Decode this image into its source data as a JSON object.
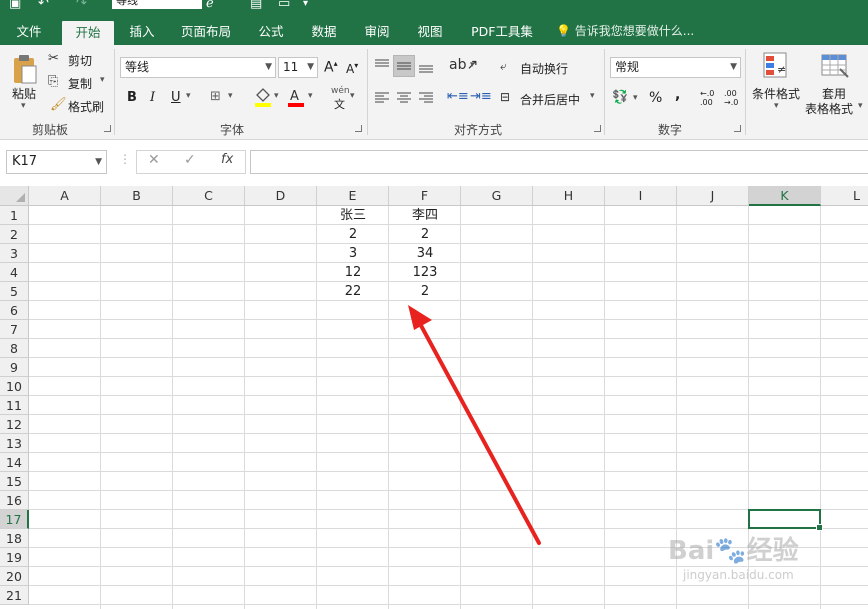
{
  "quick_access": {
    "font_name": "等线"
  },
  "tabs": [
    {
      "label": "文件",
      "active": false
    },
    {
      "label": "开始",
      "active": true
    },
    {
      "label": "插入",
      "active": false
    },
    {
      "label": "页面布局",
      "active": false
    },
    {
      "label": "公式",
      "active": false
    },
    {
      "label": "数据",
      "active": false
    },
    {
      "label": "审阅",
      "active": false
    },
    {
      "label": "视图",
      "active": false
    },
    {
      "label": "PDF工具集",
      "active": false
    }
  ],
  "tell_me": "告诉我您想要做什么...",
  "ribbon": {
    "clipboard": {
      "paste": "粘贴",
      "cut": "剪切",
      "copy": "复制",
      "format_painter": "格式刷",
      "label": "剪贴板"
    },
    "font": {
      "font_name": "等线",
      "font_size": "11",
      "bold": "B",
      "italic": "I",
      "underline": "U",
      "grow": "A",
      "shrink": "A",
      "label": "字体",
      "phonetic_top": "wén",
      "phonetic_bottom": "文"
    },
    "alignment": {
      "wrap_text": "自动换行",
      "merge_center": "合并后居中",
      "label": "对齐方式"
    },
    "number": {
      "format": "常规",
      "percent": "%",
      "comma": ",",
      "inc_decimal": "←.0 .00",
      "dec_decimal": ".00 →.0",
      "label": "数字"
    },
    "styles": {
      "conditional": "条件格式",
      "table_line1": "套用",
      "table_line2": "表格格式"
    }
  },
  "formula_bar": {
    "name_box": "K17",
    "fx": "fx",
    "value": ""
  },
  "sheet": {
    "columns": [
      "A",
      "B",
      "C",
      "D",
      "E",
      "F",
      "G",
      "H",
      "I",
      "J",
      "K",
      "L"
    ],
    "rows": [
      "1",
      "2",
      "3",
      "4",
      "5",
      "6",
      "7",
      "8",
      "9",
      "10",
      "11",
      "12",
      "13",
      "14",
      "15",
      "16",
      "17",
      "18",
      "19",
      "20",
      "21"
    ],
    "selected_cell": "K17",
    "cells": {
      "E1": "张三",
      "F1": "李四",
      "E2": "2",
      "F2": "2",
      "E3": "3",
      "F3": "34",
      "E4": "12",
      "F4": "123",
      "E5": "22",
      "F5": "2"
    }
  },
  "annotation": {
    "color": "#e8231f"
  },
  "watermark": {
    "brand": "Bai🐾经验",
    "url": "jingyan.baidu.com"
  }
}
